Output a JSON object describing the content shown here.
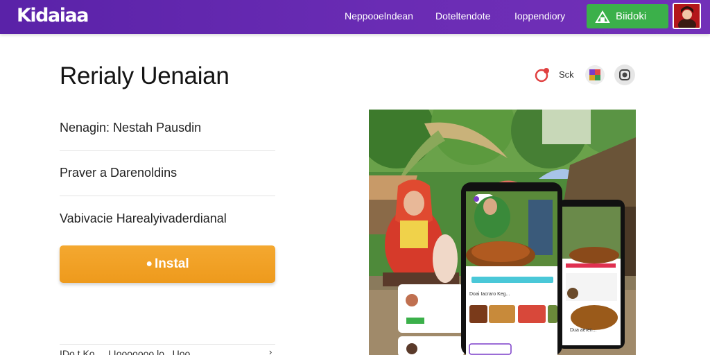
{
  "header": {
    "logo": "Kidaiaa",
    "nav": [
      "Neppooelndean",
      "Doteltendote",
      "Ioppendiory"
    ],
    "cta_label": "Biidoki"
  },
  "main": {
    "title": "Rerialy Uenaian",
    "rows": [
      "Nenagin: Nestah Pausdin",
      "Praver a Darenoldins",
      "Vabivacie Harealyivaderdianal"
    ],
    "install_label": "Instal",
    "footer_text": "IDo.t Ko.....I Iooooooo.lo...Uoo..."
  },
  "share": {
    "label": "Sck"
  },
  "hero": {
    "phone_main": {
      "caption": "Doai Iacraro Keg..."
    },
    "phone_side": {
      "caption": "Dua aeren..."
    }
  },
  "colors": {
    "header_bg": "#6428b0",
    "cta_green": "#3bb04a",
    "install_orange": "#f0a024"
  }
}
